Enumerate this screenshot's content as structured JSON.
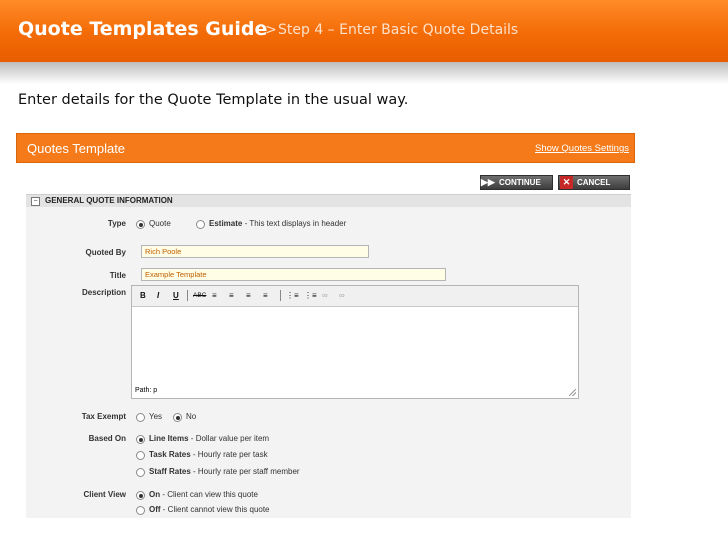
{
  "slide": {
    "title": "Quote Templates Guide",
    "separator": ">",
    "subtitle": "Step 4 – Enter Basic Quote Details",
    "intro": "Enter details for the Quote Template in the usual way."
  },
  "app": {
    "title": "Quotes Template",
    "settings_link": "Show Quotes Settings",
    "continue_label": "CONTINUE",
    "cancel_label": "CANCEL",
    "section_title": "GENERAL QUOTE INFORMATION"
  },
  "form": {
    "type": {
      "label": "Type",
      "options": [
        {
          "label": "Quote",
          "desc": "",
          "selected": true
        },
        {
          "label": "Estimate",
          "desc": " - This text displays in header",
          "selected": false
        }
      ]
    },
    "quoted_by": {
      "label": "Quoted By",
      "value": "Rich Poole"
    },
    "title": {
      "label": "Title",
      "value": "Example Template"
    },
    "description": {
      "label": "Description",
      "toolbar": [
        "B",
        "I",
        "U",
        "ABC",
        "align-left-icon",
        "align-center-icon",
        "align-right-icon",
        "align-justify-icon",
        "bullet-list-icon",
        "numbered-list-icon",
        "link-icon",
        "unlink-icon"
      ],
      "status_path": "Path: p"
    },
    "tax_exempt": {
      "label": "Tax Exempt",
      "options": [
        {
          "label": "Yes",
          "selected": false
        },
        {
          "label": "No",
          "selected": true
        }
      ]
    },
    "based_on": {
      "label": "Based On",
      "options": [
        {
          "label": "Line Items",
          "desc": " - Dollar value per item",
          "selected": true
        },
        {
          "label": "Task Rates",
          "desc": " - Hourly rate per task",
          "selected": false
        },
        {
          "label": "Staff Rates",
          "desc": " - Hourly rate per staff member",
          "selected": false
        }
      ]
    },
    "client_view": {
      "label": "Client View",
      "options": [
        {
          "label": "On",
          "desc": " - Client can view this quote",
          "selected": true
        },
        {
          "label": "Off",
          "desc": " - Client cannot view this quote",
          "selected": false
        }
      ]
    }
  },
  "colors": {
    "header_orange": "#f36b07",
    "app_bar_orange": "#f47a1a",
    "input_bg": "#fffde5",
    "input_text": "#c06000"
  }
}
